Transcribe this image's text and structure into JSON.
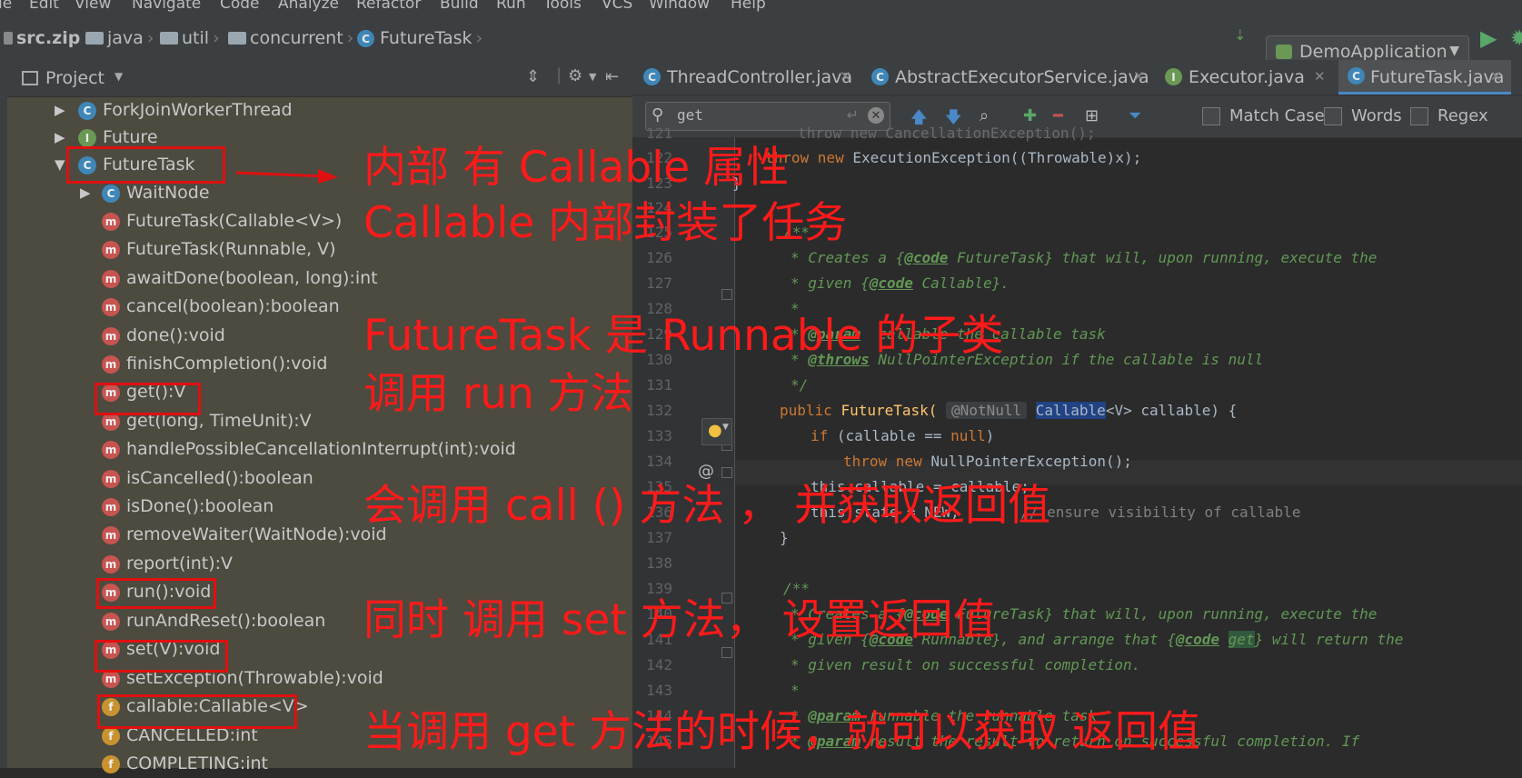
{
  "menu": [
    "le",
    "Edit",
    "View",
    "Navigate",
    "Code",
    "Analyze",
    "Refactor",
    "Build",
    "Run",
    "Tools",
    "VCS",
    "Window",
    "Help"
  ],
  "breadcrumb": [
    "src.zip",
    "java",
    "util",
    "concurrent",
    "FutureTask"
  ],
  "run_config": "DemoApplication",
  "project_panel": {
    "title": "Project",
    "tree": [
      {
        "label": "ForkJoinWorkerThread",
        "icon": "C"
      },
      {
        "label": "Future",
        "icon": "I"
      },
      {
        "label": "FutureTask",
        "icon": "C"
      },
      {
        "label": "WaitNode",
        "icon": "C"
      },
      {
        "label": "FutureTask(Callable<V>)",
        "icon": "m"
      },
      {
        "label": "FutureTask(Runnable, V)",
        "icon": "m"
      },
      {
        "label": "awaitDone(boolean, long):int",
        "icon": "m"
      },
      {
        "label": "cancel(boolean):boolean",
        "icon": "m"
      },
      {
        "label": "done():void",
        "icon": "m"
      },
      {
        "label": "finishCompletion():void",
        "icon": "m"
      },
      {
        "label": "get():V",
        "icon": "m"
      },
      {
        "label": "get(long, TimeUnit):V",
        "icon": "m"
      },
      {
        "label": "handlePossibleCancellationInterrupt(int):void",
        "icon": "m"
      },
      {
        "label": "isCancelled():boolean",
        "icon": "m"
      },
      {
        "label": "isDone():boolean",
        "icon": "m"
      },
      {
        "label": "removeWaiter(WaitNode):void",
        "icon": "m"
      },
      {
        "label": "report(int):V",
        "icon": "m"
      },
      {
        "label": "run():void",
        "icon": "m"
      },
      {
        "label": "runAndReset():boolean",
        "icon": "m"
      },
      {
        "label": "set(V):void",
        "icon": "m"
      },
      {
        "label": "setException(Throwable):void",
        "icon": "m"
      },
      {
        "label": "callable:Callable<V>",
        "icon": "f"
      },
      {
        "label": "CANCELLED:int",
        "icon": "f"
      },
      {
        "label": "COMPLETING:int",
        "icon": "f"
      }
    ]
  },
  "annotations": [
    "内部 有 Callable 属性",
    "Callable 内部封装了任务",
    "FutureTask 是 Runnable 的子类",
    "调用 run 方法",
    "会调用 call () 方法 ， 并获取返回值",
    "同时 调用 set 方法， 设置返回值",
    "当调用 get 方法的时候，就可以获取 返回值"
  ],
  "editor": {
    "tabs": [
      {
        "label": "ThreadController.java",
        "active": false
      },
      {
        "label": "AbstractExecutorService.java",
        "active": false
      },
      {
        "label": "Executor.java",
        "active": false
      },
      {
        "label": "FutureTask.java",
        "active": true
      }
    ],
    "find": {
      "query": "get",
      "options": [
        "Match Case",
        "Words",
        "Regex"
      ]
    },
    "line_numbers": [
      "121",
      "122",
      "123",
      "124",
      "125",
      "126",
      "127",
      "128",
      "129",
      "130",
      "131",
      "132",
      "133",
      "134",
      "135",
      "136",
      "137",
      "138",
      "139",
      "140",
      "141",
      "142",
      "143",
      "144",
      "145"
    ]
  },
  "code": {
    "l121": "throw new CancellationException();",
    "l122_a": "throw new ",
    "l122_b": "ExecutionException((Throwable)x);",
    "l123": "}",
    "l125": "/**",
    "l126_a": "* Creates a {",
    "l126_tag": "@code",
    "l126_b": " FutureTask} that will, upon running, execute the",
    "l127_a": "* given {",
    "l127_tag": "@code",
    "l127_b": " Callable}.",
    "l128": "*",
    "l129_a": "* ",
    "l129_tag": "@param",
    "l129_b": "  callable the callable task",
    "l130_a": "* ",
    "l130_tag": "@throws",
    "l130_b": " NullPointerException if the callable is null",
    "l131": "*/",
    "l132_kw": "public",
    "l132_name": "FutureTask(",
    "l132_hint": "@NotNull",
    "l132_type": "Callable",
    "l132_rest": "<V> callable) {",
    "l133_kw": "if",
    "l133_a": " (callable == ",
    "l133_null": "null",
    "l133_b": ")",
    "l134_kw": "throw new",
    "l134_b": " NullPointerException();",
    "l135": "this.callable = callable;",
    "l136_a": "this.state = NEW;",
    "l136_b": "       // ensure visibility of callable",
    "l137": "}",
    "l139": "/**",
    "l140_a": "* Creates a {",
    "l140_tag": "@code",
    "l140_b": " FutureTask} that will, upon running, execute the",
    "l141_a": "* given {",
    "l141_tag": "@code",
    "l141_b": " Runnable}, and arrange that {",
    "l141_tag2": "@code",
    "l141_get": "get",
    "l141_c": "} will return the",
    "l142": "* given result on successful completion.",
    "l143": "*",
    "l144_a": "* ",
    "l144_tag": "@param",
    "l144_b": " runnable the runnable task",
    "l145_a": "* ",
    "l145_tag": "@param",
    "l145_b": " result the result to return on successful completion. If",
    "gutter_at": "@"
  }
}
